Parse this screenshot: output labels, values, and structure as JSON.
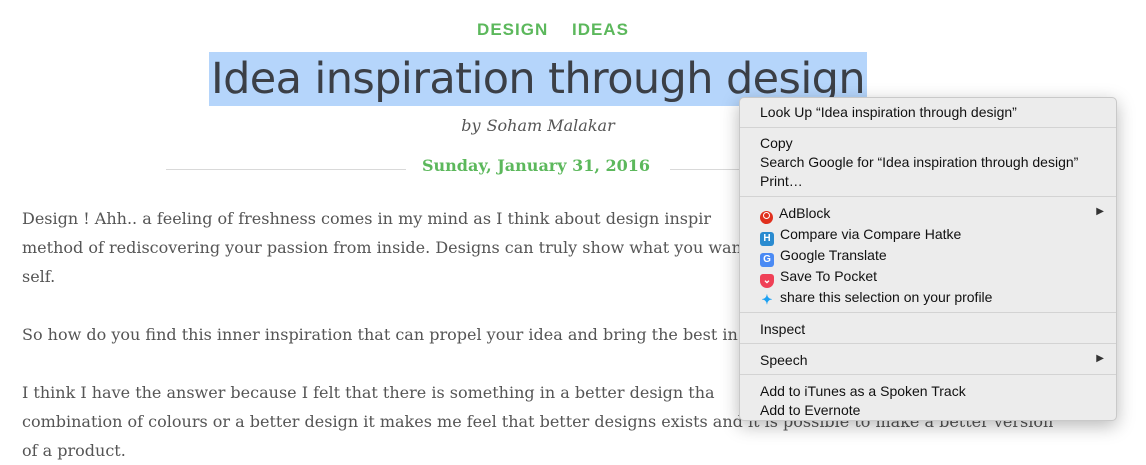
{
  "colors": {
    "accent_green": "#5cb85c",
    "title_text": "#3b3f46",
    "selection": "#b5d5fb"
  },
  "article_header": {
    "categories": [
      "DESIGN",
      "IDEAS"
    ],
    "title": "Idea inspiration through design",
    "by": "by",
    "author": "Soham Malakar",
    "date": "Sunday, January 31, 2016"
  },
  "article": {
    "p1_line1": "Design ! Ahh.. a feeling of freshness comes in my mind as I think about design inspir",
    "p1_line2": "method of rediscovering your passion from inside. Designs can truly show what you wan",
    "p1_line3": "self.",
    "p2_line1": "So how do you find this inner inspiration that can propel your idea and bring the best in y",
    "p3_line1": "I think I have the answer because I felt that there is something in a better design tha",
    "p3_line2": "combination of colours or a better design it makes me feel that better designs exists and it is possible to make a better version",
    "p3_line3": "of a product."
  },
  "context_menu": {
    "look_up": "Look Up “Idea inspiration through design”",
    "copy": "Copy",
    "search_google": "Search Google for “Idea inspiration through design”",
    "print": "Print…",
    "adblock": "AdBlock",
    "compare": "Compare via Compare Hatke",
    "translate": "Google Translate",
    "pocket": "Save To Pocket",
    "share": "share this selection on your profile",
    "inspect": "Inspect",
    "speech": "Speech",
    "itunes": "Add to iTunes as a Spoken Track",
    "evernote": "Add to Evernote",
    "icons": {
      "adblock": "adblock-icon",
      "compare": "compare-hatke-icon",
      "translate": "google-translate-icon",
      "pocket": "pocket-icon",
      "share": "twitter-bird-icon",
      "submenu": "submenu-arrow-icon"
    }
  }
}
